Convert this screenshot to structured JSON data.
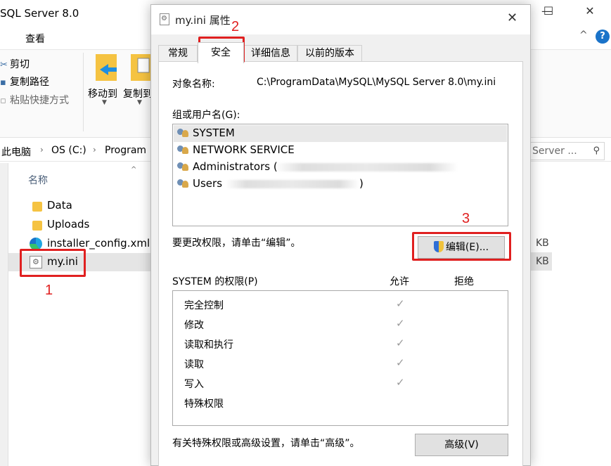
{
  "explorer": {
    "title": "SQL Server 8.0",
    "menu_view": "查看",
    "ribbon": {
      "cut": "剪切",
      "copy_path": "复制路径",
      "paste_shortcut": "粘贴快捷方式",
      "move_to": "移动到",
      "copy_to": "复制到"
    },
    "breadcrumb": [
      "此电脑",
      "OS (C:)",
      "Program"
    ],
    "search_placeholder": "Server ...",
    "column_name": "名称",
    "files": [
      {
        "name": "Data",
        "type": "folder",
        "size": ""
      },
      {
        "name": "Uploads",
        "type": "folder",
        "size": ""
      },
      {
        "name": "installer_config.xml",
        "type": "xml",
        "size": "KB"
      },
      {
        "name": "my.ini",
        "type": "ini",
        "size": "KB"
      }
    ]
  },
  "dialog": {
    "title": "my.ini 属性",
    "close_glyph": "✕",
    "tabs": [
      "常规",
      "安全",
      "详细信息",
      "以前的版本"
    ],
    "active_tab": "安全",
    "object_name_label": "对象名称:",
    "object_name_value": "C:\\ProgramData\\MySQL\\MySQL Server 8.0\\my.ini",
    "groups_label": "组或用户名(G):",
    "groups": [
      {
        "name": "SYSTEM",
        "redacted": false
      },
      {
        "name": "NETWORK SERVICE",
        "redacted": false
      },
      {
        "name": "Administrators (",
        "redacted": true
      },
      {
        "name": "Users",
        "redacted": true,
        "suffix": ")"
      }
    ],
    "change_hint": "要更改权限，请单击“编辑”。",
    "edit_button": "编辑(E)...",
    "permissions_label": "SYSTEM 的权限(P)",
    "allow_label": "允许",
    "deny_label": "拒绝",
    "permissions": [
      {
        "name": "完全控制",
        "allow": true
      },
      {
        "name": "修改",
        "allow": true
      },
      {
        "name": "读取和执行",
        "allow": true
      },
      {
        "name": "读取",
        "allow": true
      },
      {
        "name": "写入",
        "allow": true
      },
      {
        "name": "特殊权限",
        "allow": false
      }
    ],
    "advanced_hint": "有关特殊权限或高级设置，请单击“高级”。",
    "advanced_button": "高级(V)"
  },
  "annotations": {
    "step1": "1",
    "step2": "2",
    "step3": "3",
    "color": "#e02020"
  },
  "colors": {
    "accent": "#1a73c9",
    "selection": "#e5e5e5"
  }
}
